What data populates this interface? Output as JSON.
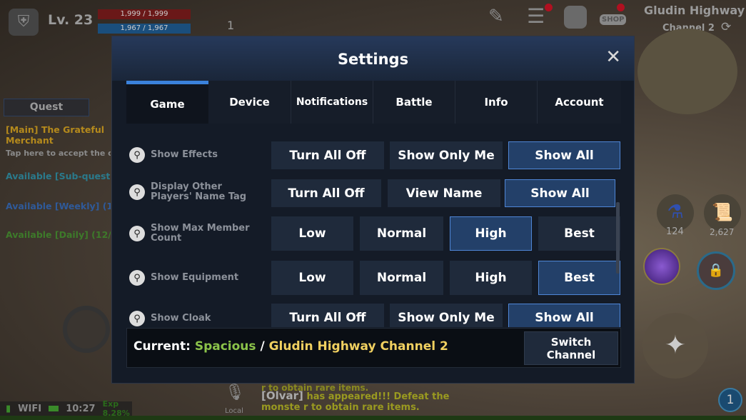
{
  "hud": {
    "level": "Lv. 23",
    "hp": "1,999 / 1,999",
    "mp": "1,967 / 1,967",
    "buff_count": "1",
    "location": "Gludin Highway",
    "channel": "Channel 2",
    "shop_label": "SHOP",
    "quest_tab": "Quest",
    "quests": [
      {
        "text": "[Main] The Grateful Merchant",
        "color": "#b58a1c"
      },
      {
        "text": "Tap here to accept the qu",
        "color": "#9c9c9c"
      },
      {
        "text": "Available [Sub-quest",
        "color": "#2a7a8c"
      },
      {
        "text": "Available [Weekly] (1",
        "color": "#2f5a9a"
      },
      {
        "text": "Available [Daily] (12/",
        "color": "#3d7a2a"
      }
    ],
    "items": [
      {
        "count": "124"
      },
      {
        "count": "2,627"
      }
    ],
    "status": {
      "network": "WIFI",
      "time": "10:27",
      "exp": "Exp 8.28%"
    },
    "chat": {
      "voice_label": "Local",
      "speaker": "[Olvar]",
      "message": "has appeared!!! Defeat the monste r to obtain rare items.",
      "partial": "r to obtain rare items."
    },
    "notif_badge": "1"
  },
  "modal": {
    "title": "Settings",
    "close": "✕",
    "tabs": [
      {
        "label": "Game",
        "active": true
      },
      {
        "label": "Device"
      },
      {
        "label": "Notifications"
      },
      {
        "label": "Battle"
      },
      {
        "label": "Info"
      },
      {
        "label": "Account"
      }
    ],
    "rows": [
      {
        "label": "Show Effects",
        "options": [
          "Turn All Off",
          "Show Only Me",
          "Show All"
        ],
        "selected": 2
      },
      {
        "label": "Display Other Players' Name Tag",
        "options": [
          "Turn All Off",
          "View Name",
          "Show All"
        ],
        "selected": 2
      },
      {
        "label": "Show Max Member Count",
        "options": [
          "Low",
          "Normal",
          "High",
          "Best"
        ],
        "selected": 2
      },
      {
        "label": "Show Equipment",
        "options": [
          "Low",
          "Normal",
          "High",
          "Best"
        ],
        "selected": 3
      },
      {
        "label": "Show Cloak",
        "options": [
          "Turn All Off",
          "Show Only Me",
          "Show All"
        ],
        "selected": 2
      }
    ],
    "footer": {
      "current_label": "Current:",
      "server": "Spacious",
      "sep": " / ",
      "channel": "Gludin Highway Channel 2",
      "switch_button": "Switch Channel"
    },
    "colors": {
      "accent": "#3b82dc",
      "server": "#8bc34a",
      "channel": "#f0d060"
    }
  }
}
